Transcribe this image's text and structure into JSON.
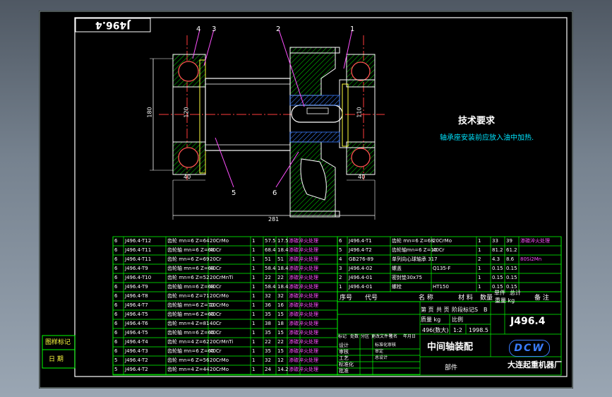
{
  "drawing_no": "J496.4",
  "drawing_no_mirrored": "J496.4",
  "callouts": [
    "1",
    "2",
    "3",
    "4",
    "5",
    "6"
  ],
  "dims": {
    "overall_width": "281",
    "height_left": "180",
    "height_inner": "120",
    "bore": "110",
    "bearing_w": "40",
    "flange_w": "40"
  },
  "tech": {
    "title": "技术要求",
    "text": "轴承座安装前应放入油中加热."
  },
  "parts_left": [
    [
      "6",
      "J496.4-T12",
      "齿轮 mn=6 Z=64",
      "20CrMo",
      "1",
      "57.5",
      "17.5",
      "渗碳淬火处理"
    ],
    [
      "6",
      "J496.4-T11",
      "齿轮轴 mn=6 Z=68",
      "40Cr",
      "1",
      "68.4",
      "18.4",
      "渗碳淬火处理"
    ],
    [
      "6",
      "J496.4-T11",
      "齿轮 mn=6 Z=69",
      "20Cr",
      "1",
      "51",
      "51",
      "渗碳淬火处理"
    ],
    [
      "6",
      "J496.4-T9",
      "齿轮轴 mn=6 Z=68",
      "40Cr",
      "1",
      "58.4",
      "18.4",
      "渗碳淬火处理"
    ],
    [
      "6",
      "J496.4-T10",
      "齿轮 mn=6 Z=52",
      "20CrMnTi",
      "1",
      "22",
      "22",
      "渗碳淬火处理"
    ],
    [
      "6",
      "J496.4-T9",
      "齿轮轴 mn=6 Z=68",
      "40Cr",
      "1",
      "58.4",
      "18.4",
      "渗碳淬火处理"
    ],
    [
      "6",
      "J496.4-T8",
      "齿轮 mn=6 Z=71",
      "20CrMo",
      "1",
      "32",
      "32",
      "渗碳淬火处理"
    ],
    [
      "6",
      "J496.4-T7",
      "齿轮轴 mn=6 Z=70",
      "20CrMo",
      "1",
      "36",
      "16",
      "渗碳淬火处理"
    ],
    [
      "6",
      "J496.4-T5",
      "齿轮轴 mn=6 Z=65",
      "40Cr",
      "1",
      "35",
      "15",
      "渗碳淬火处理"
    ],
    [
      "6",
      "J496.4-T6",
      "齿轮 mn=4 Z=81",
      "40Cr",
      "1",
      "38",
      "18",
      "渗碳淬火处理"
    ],
    [
      "6",
      "J496.4-T5",
      "齿轮轴 mn=6 Z=65",
      "40Cr",
      "1",
      "35",
      "15",
      "渗碳淬火处理"
    ],
    [
      "6",
      "J496.4-T4",
      "齿轮 mn=4 Z=62",
      "20CrMnTi",
      "1",
      "22",
      "22",
      "渗碳淬火处理"
    ],
    [
      "6",
      "J496.4-T3",
      "齿轮轴 mn=6 Z=65",
      "40Cr",
      "1",
      "35",
      "15",
      "渗碳淬火处理"
    ],
    [
      "5",
      "J496.4-T2",
      "齿轮 mn=6 Z=56",
      "20CrMo",
      "1",
      "32",
      "12",
      "渗碳淬火处理"
    ],
    [
      "5",
      "J496.4-T2",
      "齿轮 mn=4 Z=44",
      "20CrMo",
      "1",
      "24",
      "14.2",
      "渗碳淬火处理"
    ]
  ],
  "parts_right": [
    [
      "6",
      "J496.4-T1",
      "齿轮 mn=6 Z=68",
      "20CrMo",
      "1",
      "33",
      "39",
      "渗碳淬火处理"
    ],
    [
      "5",
      "J496.4-T2",
      "齿轮轴mn=6 Z=15",
      "40Cr",
      "1",
      "81.2",
      "61.2",
      ""
    ],
    [
      "4",
      "GB276-89",
      "单列向心球轴承 317",
      "",
      "2",
      "4.3",
      "8.6",
      "80Si2Mn"
    ],
    [
      "3",
      "J496.4-02",
      "螺盖",
      "Q135-F",
      "1",
      "0.15",
      "0.15",
      ""
    ],
    [
      "2",
      "J496.4-01",
      "密封垫30x75",
      "",
      "1",
      "0.15",
      "0.15",
      ""
    ],
    [
      "1",
      "J496.4-01",
      "螺栓",
      "HT150",
      "1",
      "0.15",
      "0.15",
      ""
    ]
  ],
  "bom_header": {
    "seq": "序号",
    "code": "代号",
    "name": "名 称",
    "qty": "数量",
    "material": "材 料",
    "unit_weight": "单件",
    "total_weight": "总计",
    "weight": "重量 kg",
    "remark": "备 注"
  },
  "title_block": {
    "drawing_no": "J496.4",
    "title": "中间轴装配",
    "unit": "部件",
    "company": "大连起重机器厂",
    "logo": "DCW",
    "stage_labels": [
      "第 页",
      "共 页",
      "阶段标记",
      "S",
      "B"
    ],
    "weight_label": "质量 kg",
    "scale_label": "比例",
    "mass": "496(数大)",
    "scale": "1:2",
    "date": "1998.5",
    "revision_header": [
      "标记",
      "处数",
      "分区",
      "更改文件号",
      "签名",
      "年月日"
    ],
    "roles": [
      "设计",
      "审核",
      "工艺",
      "标准化",
      "批准"
    ],
    "role_values": [
      "标准化审核",
      "审定",
      "总设计",
      "",
      "",
      "图纸审定"
    ]
  },
  "side_stamp": [
    "图样标记",
    "日 期"
  ]
}
